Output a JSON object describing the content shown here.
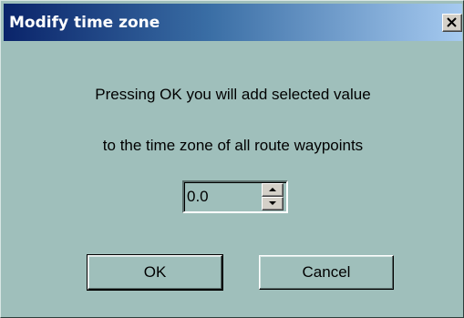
{
  "dialog": {
    "title": "Modify time zone",
    "close_icon": "close-icon"
  },
  "message": {
    "line1": "Pressing OK you will add selected value",
    "line2": "to the time zone of all route waypoints"
  },
  "offset": {
    "value": "0.0",
    "up_icon": "spin-up-arrow-icon",
    "down_icon": "spin-down-arrow-icon"
  },
  "buttons": {
    "ok_label": "OK",
    "cancel_label": "Cancel"
  },
  "colors": {
    "face": "#9fbfbb",
    "title_start": "#0a246a",
    "title_end": "#a6caf0"
  }
}
